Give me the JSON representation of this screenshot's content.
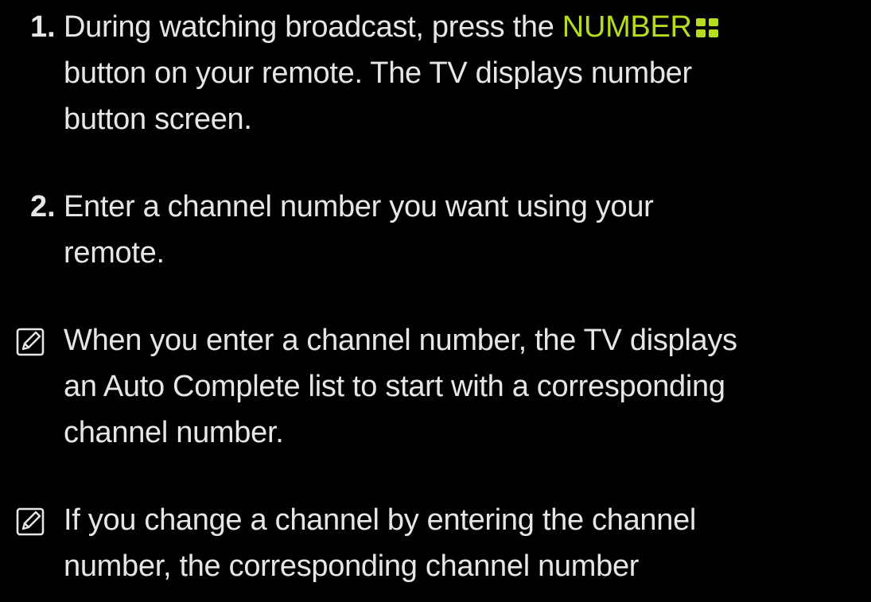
{
  "colors": {
    "background": "#000000",
    "text": "#e6e6e6",
    "highlight": "#b5dc1e"
  },
  "steps": [
    {
      "number": "1.",
      "line1_before": "During watching broadcast, press the ",
      "line1_key": "NUMBER",
      "key_icon": "grid-icon",
      "line2": "button on your remote. The TV displays number",
      "line3": "button screen."
    },
    {
      "number": "2.",
      "line1": "Enter a channel number you want using your",
      "line2": "remote."
    }
  ],
  "notes": [
    {
      "icon": "note-icon",
      "line1": "When you enter a channel number, the TV displays",
      "line2": "an Auto Complete list to start with a corresponding",
      "line3": "channel number."
    },
    {
      "icon": "note-icon",
      "line1": "If you change a channel by entering the channel",
      "line2": "number, the corresponding channel number"
    }
  ]
}
